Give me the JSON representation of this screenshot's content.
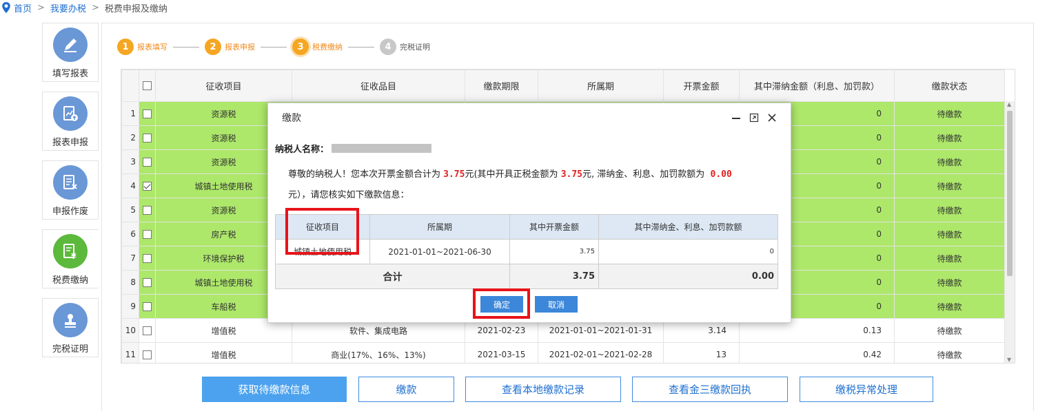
{
  "breadcrumb": {
    "home": "首页",
    "mytax": "我要办税",
    "current": "税费申报及缴纳",
    "sep1": ">",
    "sep2": ">"
  },
  "sidebar": [
    {
      "label": "填写报表",
      "icon": "pencil-icon"
    },
    {
      "label": "报表申报",
      "icon": "report-upload-icon"
    },
    {
      "label": "申报作废",
      "icon": "document-cancel-icon"
    },
    {
      "label": "税费缴纳",
      "icon": "payment-icon",
      "active": true
    },
    {
      "label": "完税证明",
      "icon": "stamp-icon"
    }
  ],
  "steps": [
    {
      "num": "1",
      "label": "报表填写"
    },
    {
      "num": "2",
      "label": "报表申报"
    },
    {
      "num": "3",
      "label": "税费缴纳"
    },
    {
      "num": "4",
      "label": "完税证明"
    }
  ],
  "table": {
    "headers": [
      "征收项目",
      "征收品目",
      "缴款期限",
      "所属期",
      "开票金额",
      "其中滞纳金额（利息、加罚款）",
      "缴款状态"
    ],
    "rows": [
      {
        "idx": "1",
        "item": "资源税",
        "sub": "",
        "deadline": "",
        "period": "",
        "amount": "",
        "late": "0",
        "status": "待缴款",
        "checked": false,
        "hl": true
      },
      {
        "idx": "2",
        "item": "资源税",
        "sub": "",
        "deadline": "",
        "period": "",
        "amount": "",
        "late": "0",
        "status": "待缴款",
        "checked": false,
        "hl": true
      },
      {
        "idx": "3",
        "item": "资源税",
        "sub": "",
        "deadline": "",
        "period": "",
        "amount": "",
        "late": "0",
        "status": "待缴款",
        "checked": false,
        "hl": true
      },
      {
        "idx": "4",
        "item": "城镇土地使用税",
        "sub": "",
        "deadline": "",
        "period": "",
        "amount": "",
        "late": "0",
        "status": "待缴款",
        "checked": true,
        "hl": true
      },
      {
        "idx": "5",
        "item": "资源税",
        "sub": "",
        "deadline": "",
        "period": "",
        "amount": "",
        "late": "0",
        "status": "待缴款",
        "checked": false,
        "hl": true
      },
      {
        "idx": "6",
        "item": "房产税",
        "sub": "",
        "deadline": "",
        "period": "",
        "amount": "",
        "late": "0",
        "status": "待缴款",
        "checked": false,
        "hl": true
      },
      {
        "idx": "7",
        "item": "环境保护税",
        "sub": "",
        "deadline": "",
        "period": "",
        "amount": "",
        "late": "0",
        "status": "待缴款",
        "checked": false,
        "hl": true
      },
      {
        "idx": "8",
        "item": "城镇土地使用税",
        "sub": "",
        "deadline": "",
        "period": "",
        "amount": "",
        "late": "0",
        "status": "待缴款",
        "checked": false,
        "hl": true
      },
      {
        "idx": "9",
        "item": "车船税",
        "sub": "",
        "deadline": "",
        "period": "",
        "amount": "",
        "late": "0",
        "status": "待缴款",
        "checked": false,
        "hl": true
      },
      {
        "idx": "10",
        "item": "增值税",
        "sub": "软件、集成电路",
        "deadline": "2021-02-23",
        "period": "2021-01-01~2021-01-31",
        "amount": "3.14",
        "late": "0.13",
        "status": "待缴款",
        "checked": false,
        "hl": false
      },
      {
        "idx": "11",
        "item": "增值税",
        "sub": "商业(17%、16%、13%)",
        "deadline": "2021-03-15",
        "period": "2021-02-01~2021-02-28",
        "amount": "13",
        "late": "0.42",
        "status": "待缴款",
        "checked": false,
        "hl": false
      }
    ]
  },
  "actions": [
    "获取待缴款信息",
    "缴款",
    "查看本地缴款记录",
    "查看金三缴款回执",
    "缴税异常处理"
  ],
  "modal": {
    "title": "缴款",
    "taxpayer_label": "纳税人名称：",
    "notice_pre": "尊敬的纳税人！您本次开票金额合计为",
    "total_amount": "3.75",
    "notice_mid": "元(其中开具正税金额为",
    "tax_amount": "3.75",
    "notice_mid2": "元, 滞纳金、利息、加罚款额为",
    "late_amount": "0.00",
    "notice_post": "元），请您核实如下缴款信息：",
    "inner_headers": [
      "征收项目",
      "所属期",
      "其中开票金额",
      "其中滞纳金、利息、加罚款额"
    ],
    "inner_row": {
      "item": "城镇土地使用税",
      "period": "2021-01-01~2021-06-30",
      "amount": "3.75",
      "late": "0"
    },
    "total_label": "合计",
    "total_amount_cell": "3.75",
    "total_late_cell": "0.00",
    "confirm": "确定",
    "cancel": "取消"
  }
}
